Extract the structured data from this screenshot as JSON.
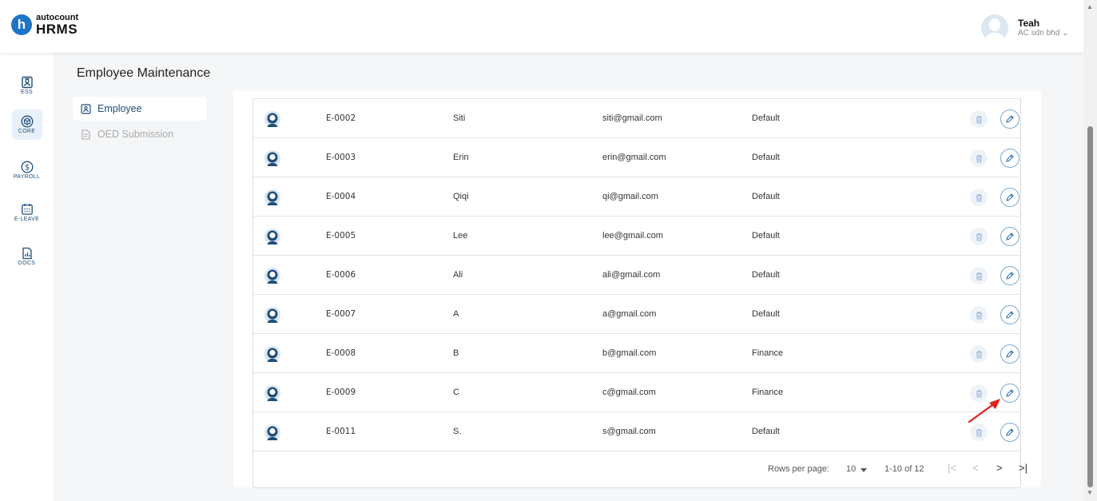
{
  "header": {
    "logo_small": "autocount",
    "logo_big": "HRMS",
    "logo_letter": "h",
    "user_name": "Teah",
    "company": "AC sdn bhd ⌄"
  },
  "rail": {
    "items": [
      {
        "label": "ESS",
        "icon": "ess-icon"
      },
      {
        "label": "CORE",
        "icon": "cube-icon"
      },
      {
        "label": "PAYROLL",
        "icon": "dollar-icon"
      },
      {
        "label": "E-LEAVE",
        "icon": "calendar-icon"
      },
      {
        "label": "DOCS",
        "icon": "docs-icon"
      }
    ]
  },
  "page": {
    "title": "Employee Maintenance"
  },
  "submenu": {
    "items": [
      {
        "label": "Employee",
        "icon": "employee-icon"
      },
      {
        "label": "OED Submission",
        "icon": "submission-icon"
      }
    ]
  },
  "table": {
    "rows": [
      {
        "id": "E-0002",
        "name": "Siti",
        "email": "siti@gmail.com",
        "department": "Default"
      },
      {
        "id": "E-0003",
        "name": "Erin",
        "email": "erin@gmail.com",
        "department": "Default"
      },
      {
        "id": "E-0004",
        "name": "Qiqi",
        "email": "qi@gmail.com",
        "department": "Default"
      },
      {
        "id": "E-0005",
        "name": "Lee",
        "email": "lee@gmail.com",
        "department": "Default"
      },
      {
        "id": "E-0006",
        "name": "Ali",
        "email": "ali@gmail.com",
        "department": "Default"
      },
      {
        "id": "E-0007",
        "name": "A",
        "email": "a@gmail.com",
        "department": "Default"
      },
      {
        "id": "E-0008",
        "name": "B",
        "email": "b@gmail.com",
        "department": "Finance"
      },
      {
        "id": "E-0009",
        "name": "C",
        "email": "c@gmail.com",
        "department": "Finance"
      },
      {
        "id": "E-0011",
        "name": "S.",
        "email": "s@gmail.com",
        "department": "Default"
      }
    ]
  },
  "pagination": {
    "rows_per_page_label": "Rows per page:",
    "rows_per_page_value": "10",
    "range": "1-10 of 12",
    "first": "|<",
    "prev": "<",
    "next": ">",
    "last": ">|"
  },
  "colors": {
    "primary": "#1e74c6",
    "nav_text": "#1f4e79",
    "annotation_arrow": "#e02020"
  }
}
